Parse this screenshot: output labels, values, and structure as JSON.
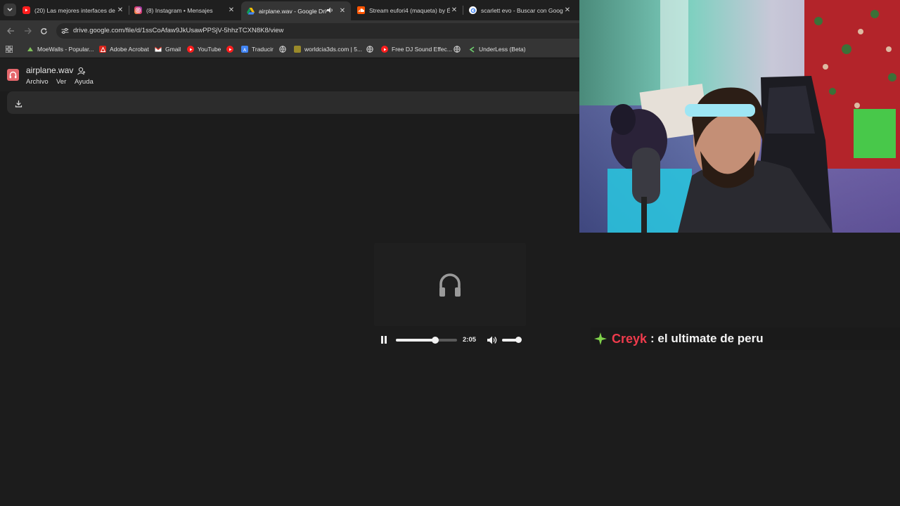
{
  "browser": {
    "tabs": [
      {
        "title": "(20) Las mejores interfaces de a",
        "icon": "youtube-icon",
        "active": false
      },
      {
        "title": "(8) Instagram • Mensajes",
        "icon": "instagram-icon",
        "active": false
      },
      {
        "title": "airplane.wav - Google Drive",
        "icon": "google-drive-icon",
        "active": true,
        "playing_audio": true
      },
      {
        "title": "Stream eufori4 (maqueta) by Éu",
        "icon": "soundcloud-icon",
        "active": false
      },
      {
        "title": "scarlett evo - Buscar con Googl",
        "icon": "google-icon",
        "active": false
      }
    ],
    "url": "drive.google.com/file/d/1ssCoAfaw9JkUsawPPSjV-5hhzTCXN8K8/view",
    "bookmarks": [
      {
        "label": "MoeWalls - Popular...",
        "icon": "moewalls-icon"
      },
      {
        "label": "Adobe Acrobat",
        "icon": "acrobat-icon"
      },
      {
        "label": "Gmail",
        "icon": "gmail-icon"
      },
      {
        "label": "YouTube",
        "icon": "youtube-icon"
      },
      {
        "label": "",
        "icon": "youtube-icon"
      },
      {
        "label": "Traducir",
        "icon": "translate-icon"
      },
      {
        "label": "",
        "icon": "globe-icon"
      },
      {
        "label": "worldcia3ds.com | 5...",
        "icon": "worldcia-icon"
      },
      {
        "label": "",
        "icon": "globe-icon"
      },
      {
        "label": "Free DJ Sound Effec...",
        "icon": "youtube-icon"
      },
      {
        "label": "",
        "icon": "globe-icon"
      },
      {
        "label": "UnderLess (Beta)",
        "icon": "underless-icon"
      }
    ]
  },
  "drive": {
    "file_title": "airplane.wav",
    "menu": [
      "Archivo",
      "Ver",
      "Ayuda"
    ]
  },
  "player": {
    "time": "2:05",
    "progress": 0.64,
    "volume": 0.85,
    "state": "playing"
  },
  "chat": {
    "user": "Creyk",
    "message": ": el ultimate de peru"
  },
  "colors": {
    "chat_user": "#ef3b4c",
    "audio_file_icon": "#e5676c"
  }
}
